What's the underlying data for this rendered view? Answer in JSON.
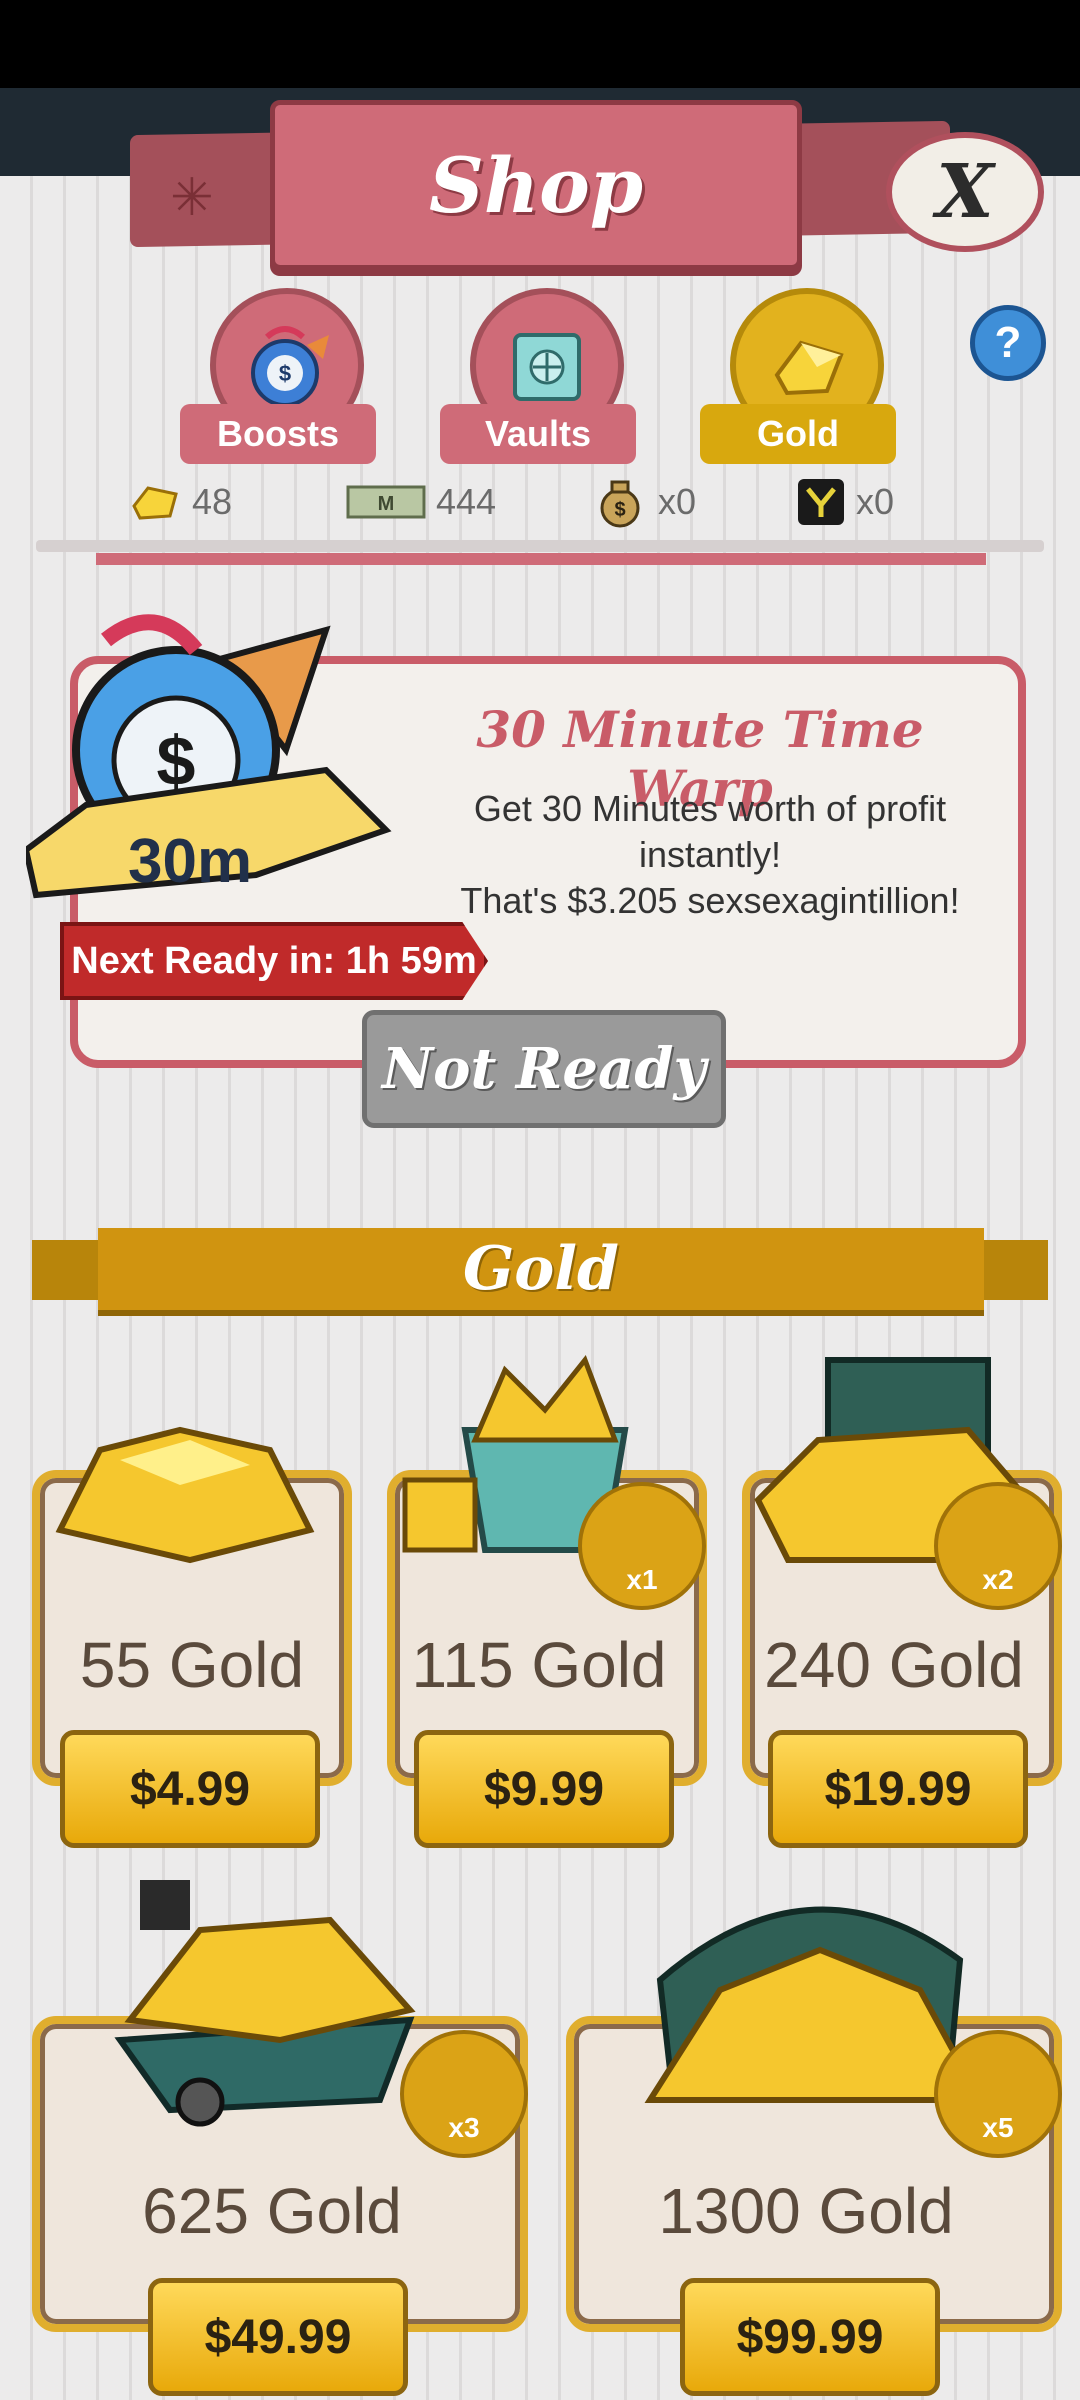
{
  "header": {
    "title": "Shop",
    "close_label": "X"
  },
  "tabs": [
    {
      "label": "Boosts",
      "active": false,
      "icon": "boost-bag-icon"
    },
    {
      "label": "Vaults",
      "active": false,
      "icon": "vault-icon"
    },
    {
      "label": "Gold",
      "active": true,
      "icon": "gold-icon"
    }
  ],
  "help_label": "?",
  "currencies": [
    {
      "icon": "gold-icon",
      "value": "48"
    },
    {
      "icon": "megabucks-icon",
      "value": "444"
    },
    {
      "icon": "moneybag-icon",
      "value": "x0"
    },
    {
      "icon": "yield-icon",
      "value": "x0"
    }
  ],
  "time_warp": {
    "title": "30 Minute Time Warp",
    "desc_line1": "Get 30 Minutes worth of profit",
    "desc_line2": "instantly!",
    "desc_line3": "That's $3.205 sexsexagintillion!",
    "badge": "30m",
    "next_ready": "Next Ready in: 1h 59m",
    "button": "Not Ready"
  },
  "gold_section": {
    "title": "Gold"
  },
  "packs": [
    {
      "name": "55 Gold",
      "price": "$4.99",
      "multiplier": ""
    },
    {
      "name": "115 Gold",
      "price": "$9.99",
      "multiplier": "x1"
    },
    {
      "name": "240 Gold",
      "price": "$19.99",
      "multiplier": "x2"
    },
    {
      "name": "625 Gold",
      "price": "$49.99",
      "multiplier": "x3"
    },
    {
      "name": "1300 Gold",
      "price": "$99.99",
      "multiplier": "x5"
    }
  ],
  "colors": {
    "accent_red": "#cf6b78",
    "gold": "#e0ae2e",
    "price_button": "#f2c23a"
  }
}
